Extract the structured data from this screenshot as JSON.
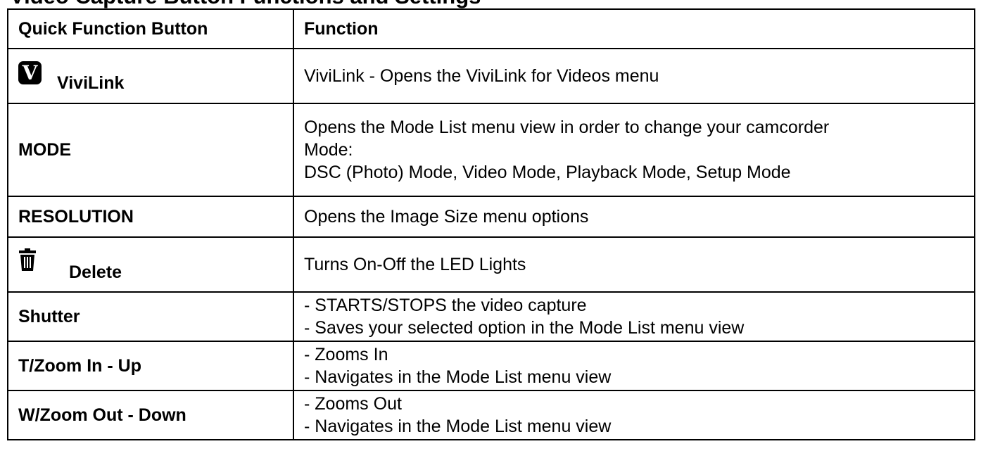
{
  "header_crop_text": "Video Capture Button Functions and Settings",
  "table": {
    "columns": [
      "Quick Function Button",
      "Function"
    ],
    "rows": [
      {
        "button": "ViviLink",
        "icon": "vivilink-v-icon",
        "icon_glyph": "V",
        "function_lines": [
          "ViviLink - Opens the ViviLink for Videos menu"
        ]
      },
      {
        "button": "MODE",
        "function_lines": [
          "Opens the Mode List menu view in order to change your camcorder",
          "Mode:",
          "DSC (Photo) Mode, Video Mode, Playback Mode, Setup Mode"
        ]
      },
      {
        "button": "RESOLUTION",
        "function_lines": [
          "Opens the Image Size menu options"
        ]
      },
      {
        "button": "Delete",
        "icon": "trash-icon",
        "function_lines": [
          "Turns On-Off the LED Lights"
        ]
      },
      {
        "button": "Shutter",
        "function_lines": [
          "- STARTS/STOPS the video capture",
          "- Saves your selected option in the Mode List menu view"
        ]
      },
      {
        "button": "T/Zoom In - Up",
        "function_lines": [
          "- Zooms In",
          "- Navigates in the Mode List menu view"
        ]
      },
      {
        "button": "W/Zoom Out - Down",
        "function_lines": [
          "- Zooms Out",
          "- Navigates in the Mode List menu view"
        ]
      }
    ]
  }
}
